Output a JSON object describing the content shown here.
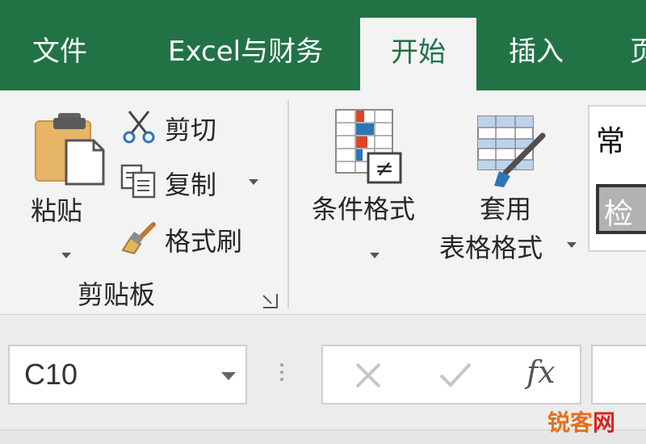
{
  "tabs": {
    "file": "文件",
    "excel_finance": "Excel与财务",
    "home": "开始",
    "insert": "插入",
    "partial_next": "页"
  },
  "clipboard": {
    "paste_label": "粘贴",
    "cut_label": "剪切",
    "copy_label": "复制",
    "format_painter_label": "格式刷",
    "group_label": "剪贴板"
  },
  "styles": {
    "conditional_formatting_label": "条件格式",
    "format_as_table_line1": "套用",
    "format_as_table_line2": "表格格式",
    "gallery_normal_partial": "常",
    "gallery_check_partial": "检"
  },
  "formula_bar": {
    "name_box_value": "C10",
    "fx_label": "fx"
  },
  "watermark": {
    "part1": "锐客",
    "part2": "网"
  },
  "colors": {
    "excel_green": "#217346",
    "ribbon_bg": "#f3f3f3"
  }
}
